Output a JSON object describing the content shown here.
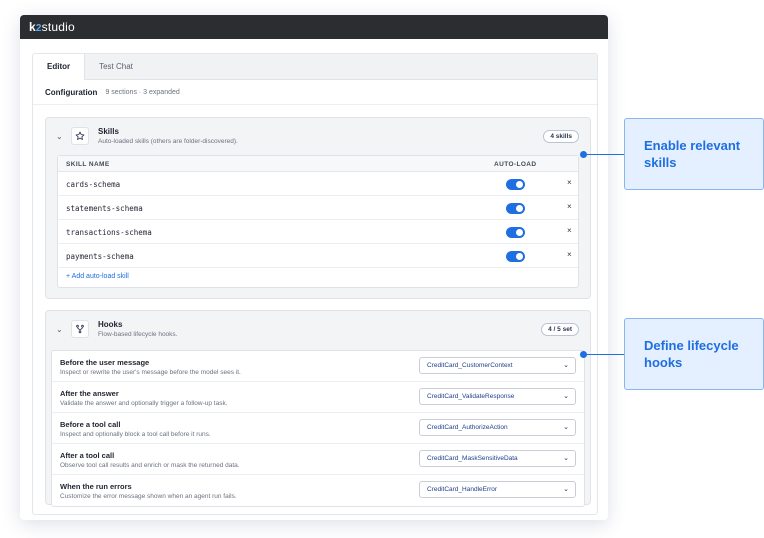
{
  "app": {
    "logo_k": "k",
    "logo_two": "2",
    "logo_rest": "studio"
  },
  "tabs": [
    {
      "label": "Editor",
      "active": true
    },
    {
      "label": "Test Chat",
      "active": false
    }
  ],
  "configuration": {
    "title": "Configuration",
    "meta": "9 sections · 3 expanded"
  },
  "skills": {
    "title": "Skills",
    "subtitle": "Auto-loaded skills (others are folder-discovered).",
    "badge": "4 skills",
    "columns": {
      "name": "SKILL NAME",
      "autoload": "AUTO-LOAD"
    },
    "items": [
      {
        "name": "cards-schema",
        "autoload": true
      },
      {
        "name": "statements-schema",
        "autoload": true
      },
      {
        "name": "transactions-schema",
        "autoload": true
      },
      {
        "name": "payments-schema",
        "autoload": true
      }
    ],
    "remove_glyph": "×",
    "add_label": "+ Add auto-load skill"
  },
  "hooks": {
    "title": "Hooks",
    "subtitle": "Flow-based lifecycle hooks.",
    "badge": "4 / 5 set",
    "items": [
      {
        "title": "Before the user message",
        "desc": "Inspect or rewrite the user's message before the model sees it.",
        "value": "CreditCard_CustomerContext"
      },
      {
        "title": "After the answer",
        "desc": "Validate the answer and optionally trigger a follow-up task.",
        "value": "CreditCard_ValidateResponse"
      },
      {
        "title": "Before a tool call",
        "desc": "Inspect and optionally block a tool call before it runs.",
        "value": "CreditCard_AuthorizeAction"
      },
      {
        "title": "After a tool call",
        "desc": "Observe tool call results and enrich or mask the returned data.",
        "value": "CreditCard_MaskSensitiveData"
      },
      {
        "title": "When the run errors",
        "desc": "Customize the error message shown when an agent run fails.",
        "value": "CreditCard_HandleError"
      }
    ]
  },
  "callouts": {
    "skills": "Enable relevant skills",
    "hooks": "Define lifecycle hooks"
  },
  "colors": {
    "accent": "#1f6fe0",
    "titlebar": "#2b2d31",
    "callout_bg": "#e4efff"
  }
}
